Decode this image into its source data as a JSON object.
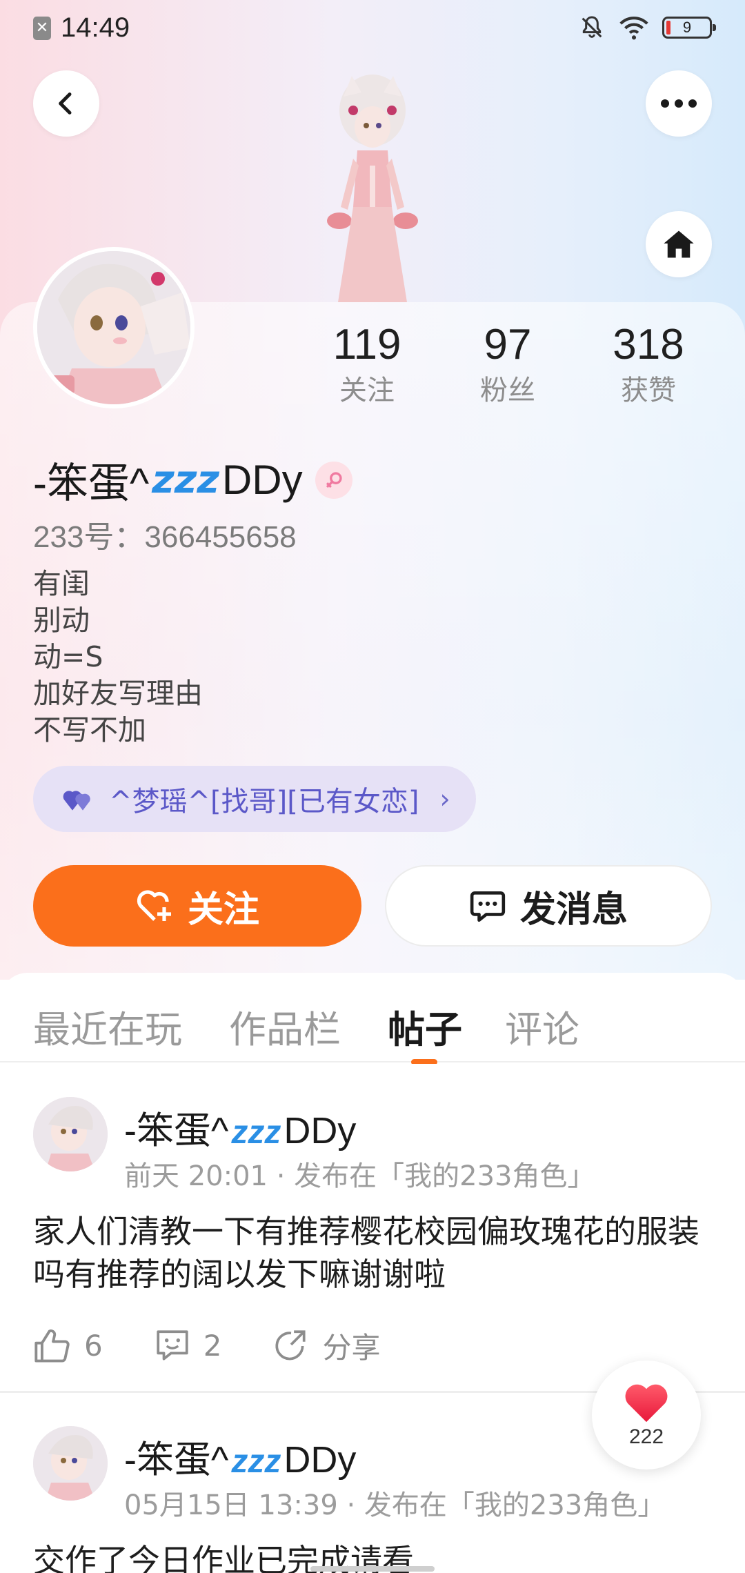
{
  "status_bar": {
    "time": "14:49",
    "battery": "9"
  },
  "profile": {
    "username": "-笨蛋^",
    "username_suffix": "DDy",
    "zzz": "zᴢz",
    "uid_label": "233号：366455658",
    "bio_lines": [
      "有闺",
      "别动",
      "动=S",
      "加好友写理由",
      "不写不加"
    ],
    "stats": [
      {
        "value": "119",
        "label": "关注"
      },
      {
        "value": "97",
        "label": "粉丝"
      },
      {
        "value": "318",
        "label": "获赞"
      }
    ],
    "relation": "^梦瑶^[找哥][已有女恋]"
  },
  "buttons": {
    "follow": "关注",
    "message": "发消息"
  },
  "tabs": [
    {
      "label": "最近在玩"
    },
    {
      "label": "作品栏"
    },
    {
      "label": "帖子"
    },
    {
      "label": "评论"
    }
  ],
  "posts": [
    {
      "author": "-笨蛋^",
      "author_suffix": "DDy",
      "meta": "前天 20:01 · 发布在「我的233角色」",
      "body": "家人们清教一下有推荐樱花校园偏玫瑰花的服装吗有推荐的阔以发下嘛谢谢啦",
      "likes": "6",
      "comments": "2",
      "share": "分享"
    },
    {
      "author": "-笨蛋^",
      "author_suffix": "DDy",
      "meta": "05月15日 13:39 · 发布在「我的233角色」",
      "body": "交作了今日作业已完成请看"
    }
  ],
  "floating_like": {
    "count": "222"
  },
  "colors": {
    "accent": "#fb6f1b",
    "relation_text": "#5b58c8",
    "zzz": "#2a8fe5"
  }
}
